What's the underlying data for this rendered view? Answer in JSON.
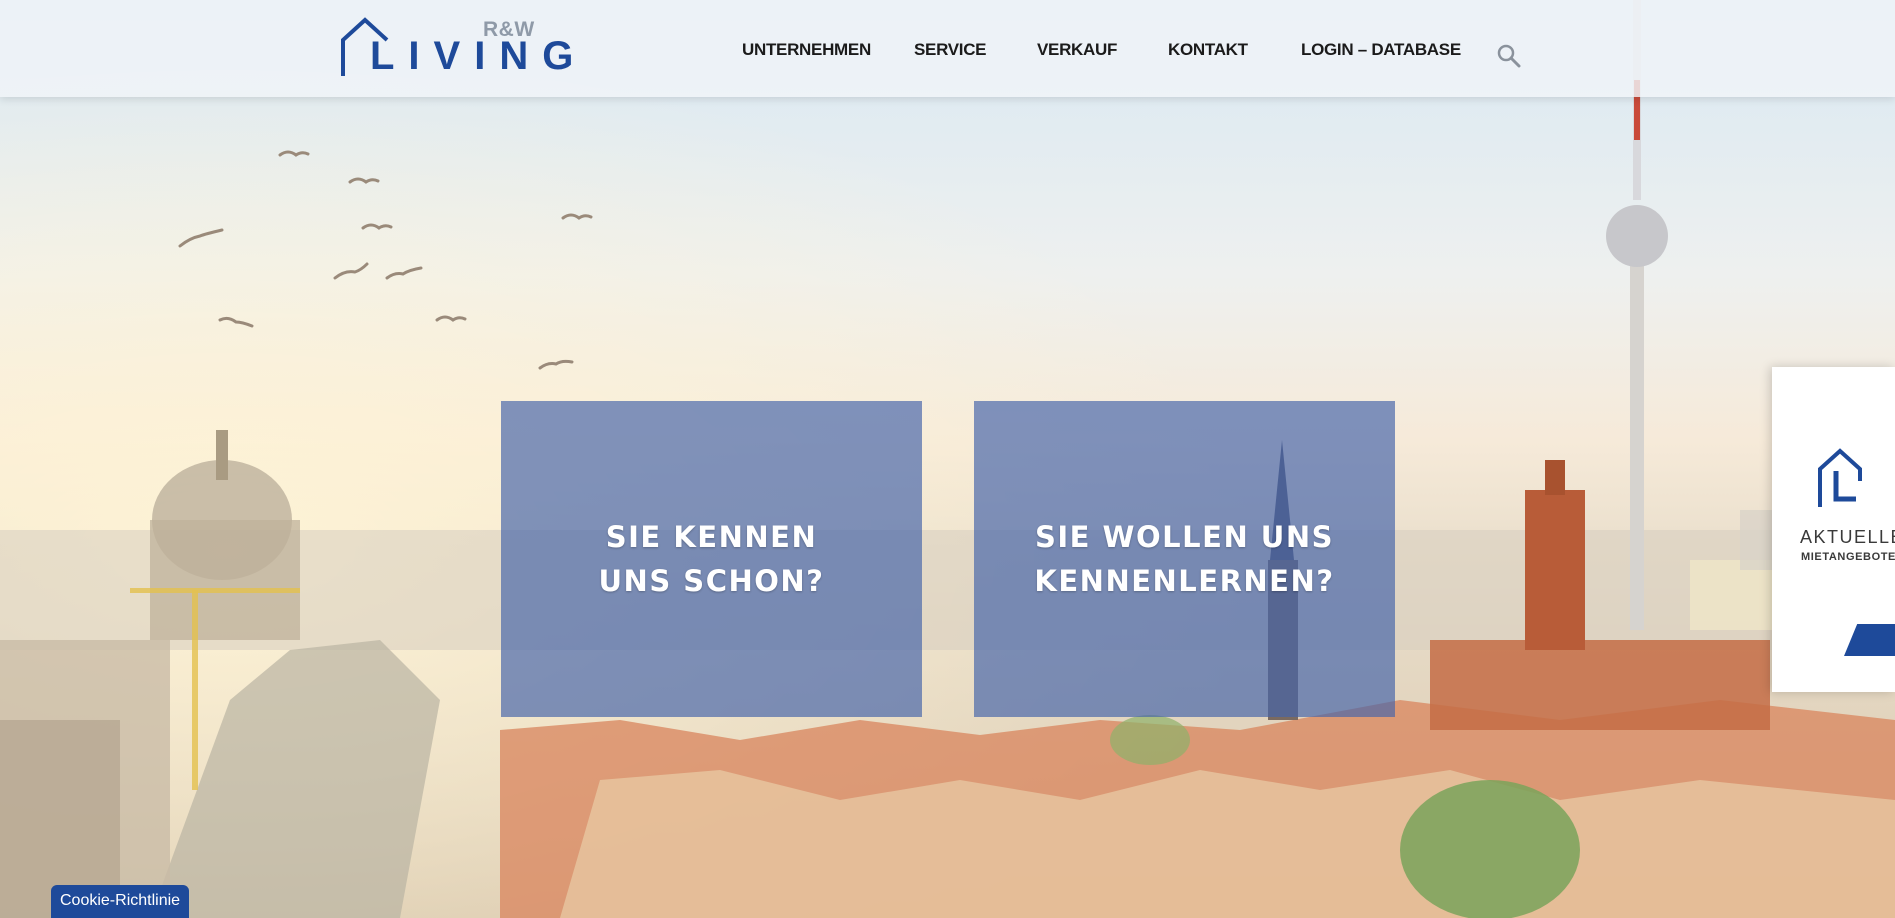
{
  "header": {
    "logo": {
      "brand_top": "R&W",
      "brand_main": "LIVING"
    },
    "nav": [
      {
        "label": "UNTERNEHMEN"
      },
      {
        "label": "SERVICE"
      },
      {
        "label": "VERKAUF"
      },
      {
        "label": "KONTAKT"
      },
      {
        "label": "LOGIN – DATABASE"
      }
    ],
    "search_icon": "search-icon"
  },
  "tiles": [
    {
      "line1": "SIE KENNEN",
      "line2": "UNS SCHON?"
    },
    {
      "line1": "SIE WOLLEN UNS",
      "line2": "KENNENLERNEN?"
    }
  ],
  "side_widget": {
    "title": "AKTUELLE",
    "subtitle": "MIETANGEBOTE",
    "icon": "house-l-icon"
  },
  "cookie": {
    "label": "Cookie-Richtlinie"
  },
  "colors": {
    "brand_blue": "#1e4a9a",
    "tile_overlay": "#4664aa",
    "logo_gray": "#8f9aa8"
  }
}
